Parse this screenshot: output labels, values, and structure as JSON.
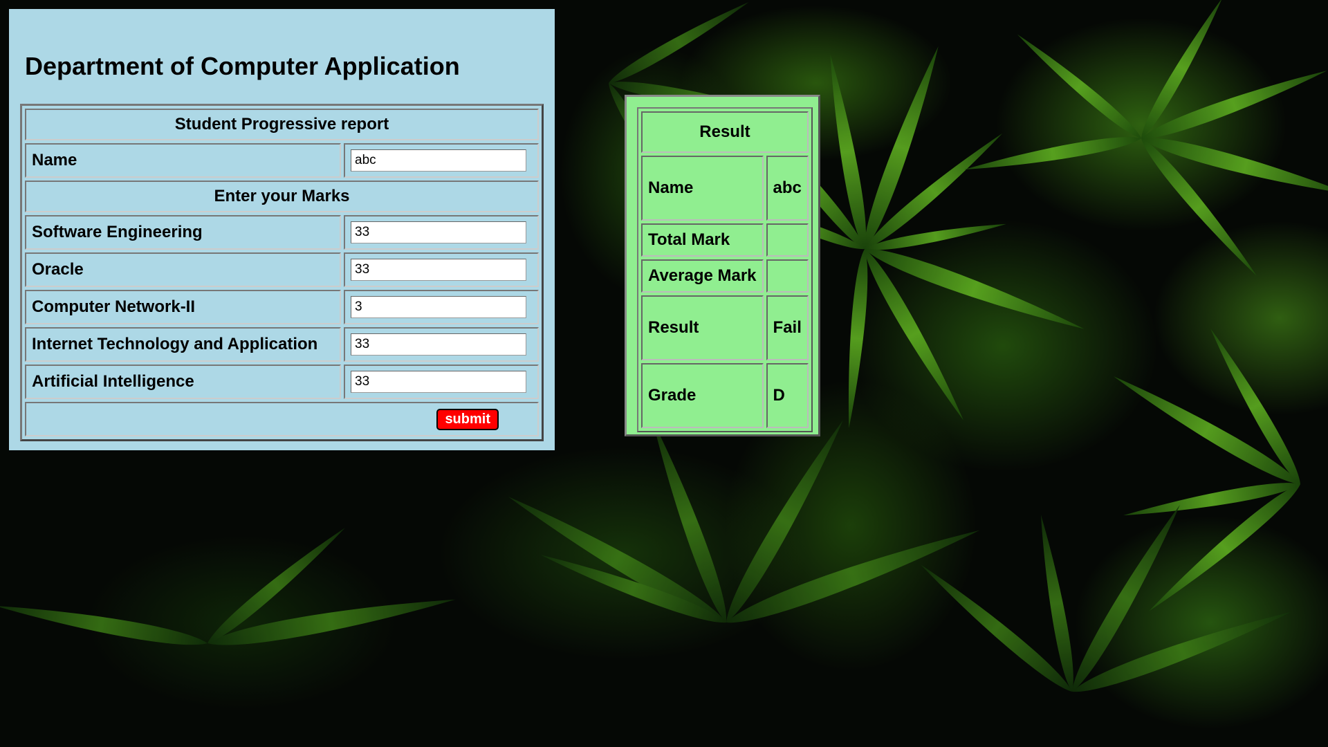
{
  "page": {
    "title": "Department of Computer Application"
  },
  "form": {
    "caption": "Student Progressive report",
    "name_label": "Name",
    "name_value": "abc",
    "marks_heading": "Enter your Marks",
    "subjects": [
      {
        "label": "Software Engineering",
        "value": "33"
      },
      {
        "label": "Oracle",
        "value": "33"
      },
      {
        "label": "Computer Network-II",
        "value": "3"
      },
      {
        "label": "Internet Technology and Application",
        "value": "33"
      },
      {
        "label": "Artificial Intelligence",
        "value": "33"
      }
    ],
    "submit_label": "submit",
    "submit_color": "#ff0000",
    "panel_color": "#add8e6"
  },
  "result": {
    "heading": "Result",
    "rows": [
      {
        "label": "Name",
        "value": "abc"
      },
      {
        "label": "Total Mark",
        "value": ""
      },
      {
        "label": "Average Mark",
        "value": ""
      },
      {
        "label": "Result",
        "value": "Fail"
      },
      {
        "label": "Grade",
        "value": "D"
      }
    ],
    "panel_color": "#90ee90"
  },
  "background": {
    "description_icon": "cannabis-leaves-image"
  }
}
